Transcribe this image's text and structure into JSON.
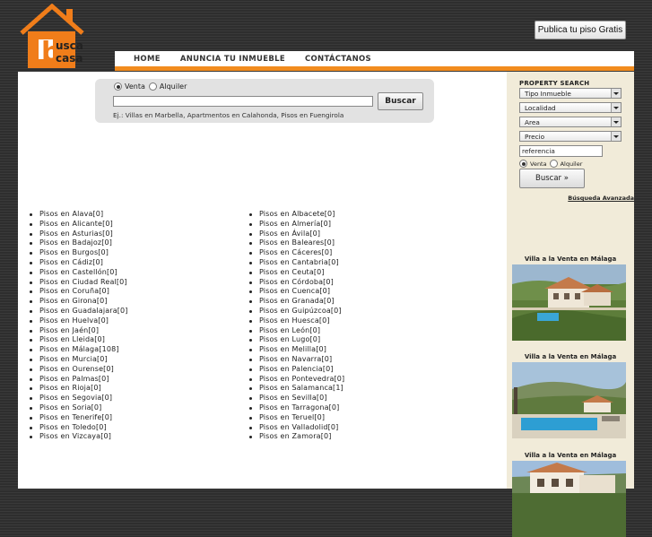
{
  "header": {
    "logo_text": "buscacasa",
    "publish_button": "Publica tu piso Gratis",
    "colors": {
      "brand_orange": "#f28c1e",
      "logo_orange": "#f07d1a"
    }
  },
  "nav": {
    "items": [
      "HOME",
      "ANUNCIA TU INMUEBLE",
      "CONTÁCTANOS"
    ]
  },
  "search": {
    "radio_sale": "Venta",
    "radio_rent": "Alquiler",
    "selected": "Venta",
    "input_value": "",
    "button": "Buscar",
    "hint": "Ej.: Villas en Marbella, Apartmentos en Calahonda, Pisos en Fuengirola"
  },
  "listings": {
    "left": [
      "Pisos en Alava[0]",
      "Pisos en Alicante[0]",
      "Pisos en Asturias[0]",
      "Pisos en Badajoz[0]",
      "Pisos en Burgos[0]",
      "Pisos en Cádiz[0]",
      "Pisos en Castellón[0]",
      "Pisos en Ciudad Real[0]",
      "Pisos en Coruña[0]",
      "Pisos en Girona[0]",
      "Pisos en Guadalajara[0]",
      "Pisos en Huelva[0]",
      "Pisos en Jaén[0]",
      "Pisos en Lleida[0]",
      "Pisos en Málaga[108]",
      "Pisos en Murcia[0]",
      "Pisos en Ourense[0]",
      "Pisos en Palmas[0]",
      "Pisos en Rioja[0]",
      "Pisos en Segovia[0]",
      "Pisos en Soria[0]",
      "Pisos en Tenerife[0]",
      "Pisos en Toledo[0]",
      "Pisos en Vizcaya[0]"
    ],
    "right": [
      "Pisos en Albacete[0]",
      "Pisos en Almería[0]",
      "Pisos en Ávila[0]",
      "Pisos en Baleares[0]",
      "Pisos en Cáceres[0]",
      "Pisos en Cantabria[0]",
      "Pisos en Ceuta[0]",
      "Pisos en Córdoba[0]",
      "Pisos en Cuenca[0]",
      "Pisos en Granada[0]",
      "Pisos en Guipúzcoa[0]",
      "Pisos en Huesca[0]",
      "Pisos en León[0]",
      "Pisos en Lugo[0]",
      "Pisos en Melilla[0]",
      "Pisos en Navarra[0]",
      "Pisos en Palencia[0]",
      "Pisos en Pontevedra[0]",
      "Pisos en Salamanca[1]",
      "Pisos en Sevilla[0]",
      "Pisos en Tarragona[0]",
      "Pisos en Teruel[0]",
      "Pisos en Valladolid[0]",
      "Pisos en Zamora[0]"
    ]
  },
  "sidebar": {
    "title": "PROPERTY SEARCH",
    "selects": [
      "Tipo Inmueble",
      "Localidad",
      "Area",
      "Precio"
    ],
    "reference_value": "referencia",
    "radio_sale": "Venta",
    "radio_rent": "Alquiler",
    "button": "Buscar »",
    "advanced_link": "Búsqueda Avanzada",
    "villas": [
      {
        "title": "Villa a la Venta en Málaga"
      },
      {
        "title": "Villa a la Venta en Málaga"
      },
      {
        "title": "Villa a la Venta en Málaga"
      }
    ]
  }
}
